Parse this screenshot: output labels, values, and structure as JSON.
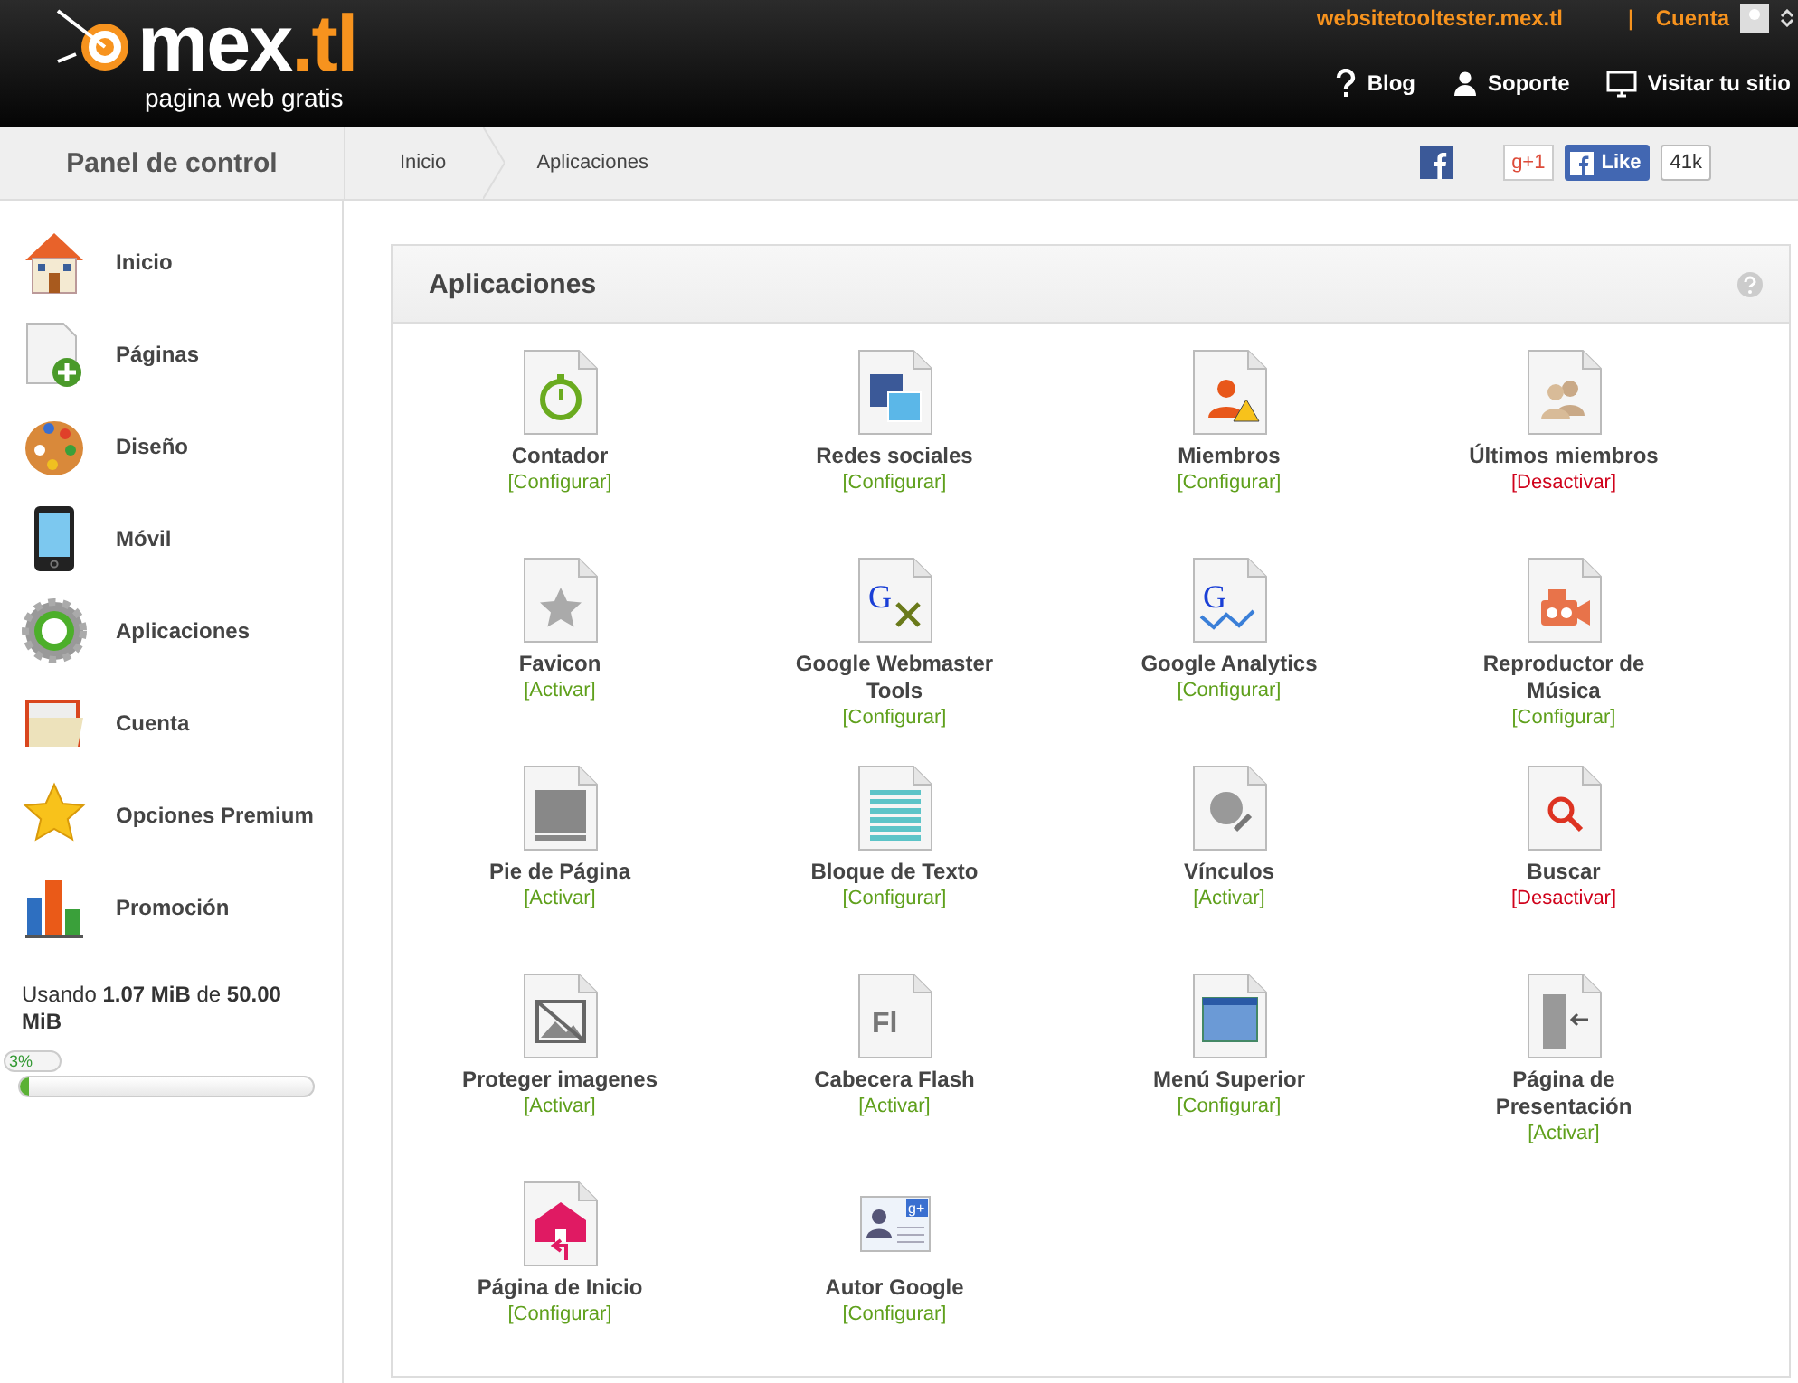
{
  "header": {
    "logo": {
      "main": "mex",
      "accent": ".tl",
      "tagline": "pagina web gratis"
    },
    "site": "websitetooltester.mex.tl",
    "separator": "|",
    "account": "Cuenta",
    "nav": [
      {
        "kind": "help",
        "label": "Blog"
      },
      {
        "kind": "person",
        "label": "Soporte"
      },
      {
        "kind": "monitor",
        "label": "Visitar tu sitio"
      }
    ]
  },
  "subheader": {
    "title": "Panel de control",
    "breadcrumb": [
      "Inicio",
      "Aplicaciones"
    ],
    "gplus": "g+1",
    "like": "Like",
    "like_count": "41k"
  },
  "sidebar": {
    "items": [
      {
        "kind": "home",
        "label": "Inicio"
      },
      {
        "kind": "page-add",
        "label": "Páginas"
      },
      {
        "kind": "palette",
        "label": "Diseño"
      },
      {
        "kind": "phone",
        "label": "Móvil"
      },
      {
        "kind": "gear",
        "label": "Aplicaciones"
      },
      {
        "kind": "folder",
        "label": "Cuenta"
      },
      {
        "kind": "star",
        "label": "Opciones Premium"
      },
      {
        "kind": "chart",
        "label": "Promoción"
      }
    ],
    "storage": {
      "text": "Usando **1.07 MiB** de **50.00 MiB**",
      "percent": "3%",
      "level": 0.03
    }
  },
  "panel": {
    "title": "Aplicaciones",
    "apps": [
      {
        "kind": "timer",
        "name": "Contador",
        "action": {
          "label": "[Configurar]",
          "kind": "configure"
        }
      },
      {
        "kind": "social",
        "name": "Redes sociales",
        "action": {
          "label": "[Configurar]",
          "kind": "configure"
        }
      },
      {
        "kind": "members",
        "name": "Miembros",
        "action": {
          "label": "[Configurar]",
          "kind": "configure"
        }
      },
      {
        "kind": "users",
        "name": "Últimos miembros",
        "action": {
          "label": "[Desactivar]",
          "kind": "deactivate"
        }
      },
      {
        "kind": "star",
        "name": "Favicon",
        "action": {
          "label": "[Activar]",
          "kind": "activate"
        }
      },
      {
        "kind": "tools",
        "name": "Google Webmaster Tools",
        "icon_text": "G",
        "action": {
          "label": "[Configurar]",
          "kind": "configure"
        }
      },
      {
        "kind": "analytics",
        "name": "Google Analytics",
        "icon_text": "G",
        "action": {
          "label": "[Configurar]",
          "kind": "configure"
        }
      },
      {
        "kind": "camera",
        "name": "Reproductor de Música",
        "action": {
          "label": "[Configurar]",
          "kind": "configure"
        }
      },
      {
        "kind": "footer",
        "name": "Pie de Página",
        "action": {
          "label": "[Activar]",
          "kind": "activate"
        }
      },
      {
        "kind": "text",
        "name": "Bloque de Texto",
        "action": {
          "label": "[Configurar]",
          "kind": "configure"
        }
      },
      {
        "kind": "links",
        "name": "Vínculos",
        "action": {
          "label": "[Activar]",
          "kind": "activate"
        }
      },
      {
        "kind": "search",
        "name": "Buscar",
        "action": {
          "label": "[Desactivar]",
          "kind": "deactivate"
        }
      },
      {
        "kind": "picture",
        "name": "Proteger imagenes",
        "action": {
          "label": "[Activar]",
          "kind": "activate"
        }
      },
      {
        "kind": "flash",
        "name": "Cabecera Flash",
        "icon_text": "Fl",
        "action": {
          "label": "[Activar]",
          "kind": "activate"
        }
      },
      {
        "kind": "menu",
        "name": "Menú Superior",
        "action": {
          "label": "[Configurar]",
          "kind": "configure"
        }
      },
      {
        "kind": "door",
        "name": "Página de Presentación",
        "action": {
          "label": "[Activar]",
          "kind": "activate"
        }
      },
      {
        "kind": "home",
        "name": "Página de Inicio",
        "action": {
          "label": "[Configurar]",
          "kind": "configure"
        }
      },
      {
        "kind": "contact",
        "name": "Autor Google",
        "icon_text": "g+",
        "action": {
          "label": "[Configurar]",
          "kind": "configure"
        }
      }
    ]
  }
}
